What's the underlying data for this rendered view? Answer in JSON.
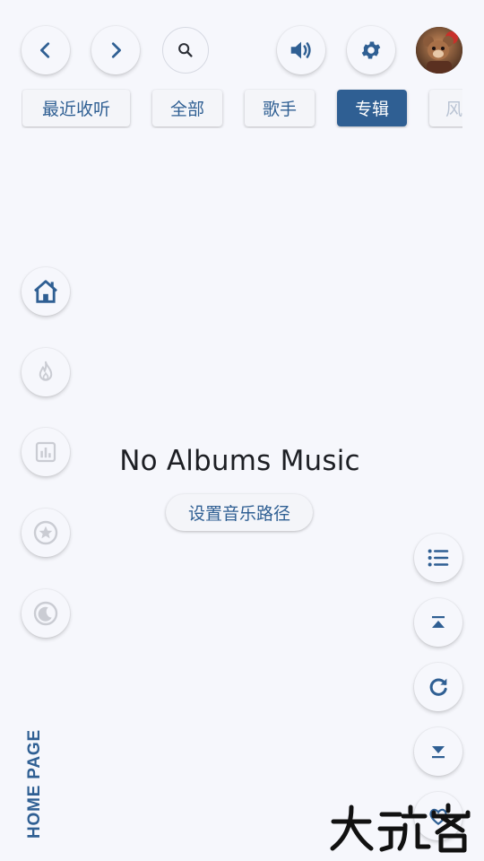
{
  "toolbar": {
    "icons": [
      "chevron-left-icon",
      "chevron-right-icon",
      "search-icon",
      "volume-icon",
      "gear-icon"
    ]
  },
  "tabs": [
    {
      "label": "最近收听",
      "active": false
    },
    {
      "label": "全部",
      "active": false
    },
    {
      "label": "歌手",
      "active": false
    },
    {
      "label": "专辑",
      "active": true
    },
    {
      "label": "风",
      "active": false
    }
  ],
  "side_nav": {
    "items": [
      "home-icon",
      "fire-icon",
      "chart-icon",
      "star-icon",
      "moon-icon"
    ],
    "label": "HOME PAGE"
  },
  "main": {
    "empty_title": "No Albums Music",
    "set_path_label": "设置音乐路径"
  },
  "right_actions": [
    "list-icon",
    "scroll-top-icon",
    "refresh-icon",
    "scroll-bottom-icon"
  ],
  "watermark": "大玩客",
  "colors": {
    "accent": "#2f5f93",
    "background": "#f6f7fc",
    "text": "#1d1f24"
  }
}
